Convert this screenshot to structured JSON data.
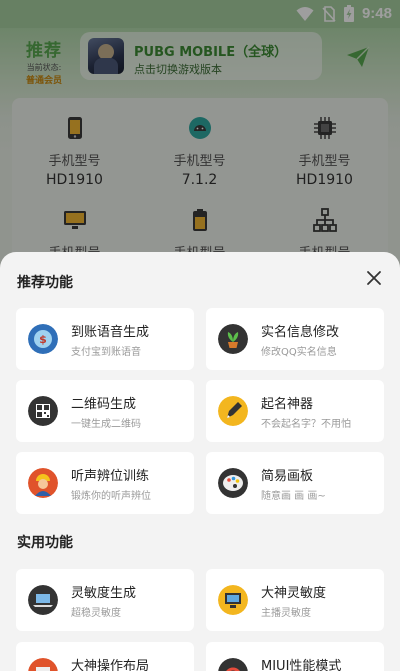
{
  "status_bar": {
    "time": "9:48",
    "icons": [
      "wifi-icon",
      "no-sim-icon",
      "battery-charging-icon"
    ]
  },
  "header": {
    "title": "推荐",
    "status_label": "当前状态:",
    "member_label": "普通会员",
    "game_name": "PUBG MOBILE（全球）",
    "game_switch_hint": "点击切换游戏版本",
    "send_icon": "send-icon"
  },
  "device_info": [
    {
      "label": "手机型号",
      "value": "HD1910",
      "icon": "phone-icon"
    },
    {
      "label": "手机型号",
      "value": "7.1.2",
      "icon": "android-icon"
    },
    {
      "label": "手机型号",
      "value": "HD1910",
      "icon": "cpu-icon"
    },
    {
      "label": "手机型号",
      "value": "",
      "icon": "monitor-icon"
    },
    {
      "label": "手机型号",
      "value": "",
      "icon": "battery-icon"
    },
    {
      "label": "手机型号",
      "value": "",
      "icon": "network-icon"
    }
  ],
  "sheet": {
    "close_icon": "close-icon",
    "recommended_title": "推荐功能",
    "recommended": [
      {
        "title": "到账语音生成",
        "desc": "支付宝到账语音",
        "icon": "voice-icon"
      },
      {
        "title": "实名信息修改",
        "desc": "修改QQ实名信息",
        "icon": "plant-icon"
      },
      {
        "title": "二维码生成",
        "desc": "一键生成二维码",
        "icon": "qrcode-icon"
      },
      {
        "title": "起名神器",
        "desc": "不会起名字？不用怕",
        "icon": "pen-icon"
      },
      {
        "title": "听声辨位训练",
        "desc": "锻炼你的听声辨位",
        "icon": "worker-icon"
      },
      {
        "title": "简易画板",
        "desc": "随意画 画 画~",
        "icon": "palette-icon"
      }
    ],
    "practical_title": "实用功能",
    "practical": [
      {
        "title": "灵敏度生成",
        "desc": "超稳灵敏度",
        "icon": "laptop-icon"
      },
      {
        "title": "大神灵敏度",
        "desc": "主播灵敏度",
        "icon": "desktop-icon"
      },
      {
        "title": "大神操作布局",
        "desc": "",
        "icon": "monitor-icon"
      },
      {
        "title": "MIUI性能模式",
        "desc": "",
        "icon": "gauge-icon"
      }
    ]
  },
  "colors": {
    "accent_green": "#58a84f",
    "member_gold": "#c98a12",
    "status_bar": "#a6cfa0"
  }
}
